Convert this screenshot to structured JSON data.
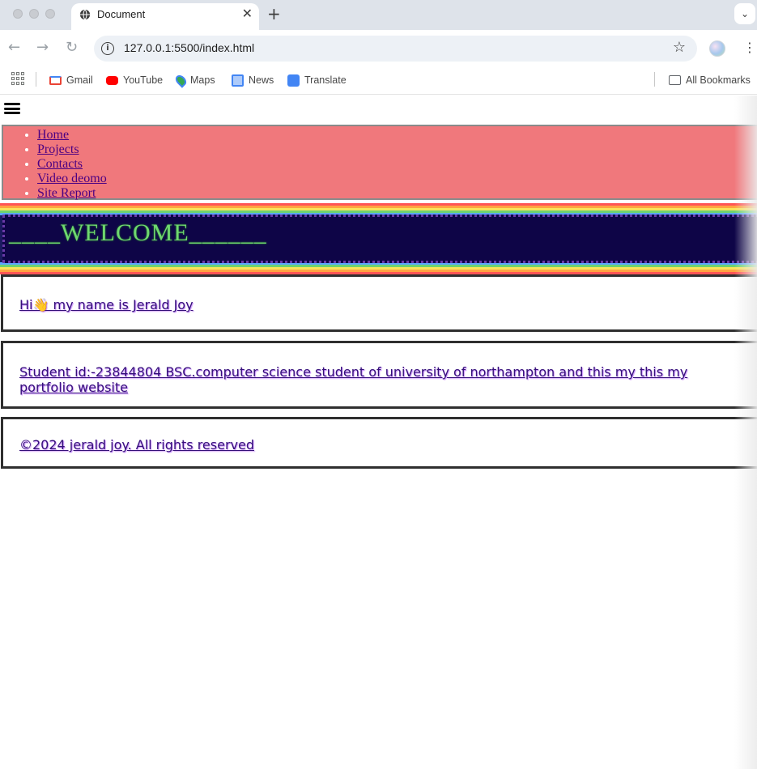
{
  "browser": {
    "tab_title": "Document",
    "tab_close": "✕",
    "new_tab": "+",
    "tab_menu": "⌄",
    "url": "127.0.0.1:5500/index.html",
    "back": "←",
    "forward": "→",
    "reload": "↻",
    "info": "i",
    "star": "☆",
    "menu": "⋮",
    "bookmarks": [
      {
        "label": "Gmail",
        "icon": "gmail-icon",
        "color": "#ea4335"
      },
      {
        "label": "YouTube",
        "icon": "youtube-icon",
        "color": "#ff0000"
      },
      {
        "label": "Maps",
        "icon": "maps-icon",
        "color": "#34a853"
      },
      {
        "label": "News",
        "icon": "news-icon",
        "color": "#4285f4"
      },
      {
        "label": "Translate",
        "icon": "translate-icon",
        "color": "#4285f4"
      }
    ],
    "all_bookmarks": "All Bookmarks"
  },
  "nav": {
    "items": [
      "Home",
      "Projects",
      "Contacts",
      "Video deomo",
      "Site Report"
    ]
  },
  "banner": {
    "text": "____WELCOME______"
  },
  "cards": {
    "greeting": "Hi👋 my name is Jerald Joy",
    "about": "Student id:-23844804 BSC.computer science student of university of northampton and this my this my portfolio website",
    "footer": "©2024 jerald joy. All rights reserved"
  },
  "colors": {
    "nav_bg": "#f0787c",
    "link": "#4b0082",
    "banner_bg": "#0e0547",
    "banner_text": "#6fd86f",
    "card_text": "#35107a"
  }
}
